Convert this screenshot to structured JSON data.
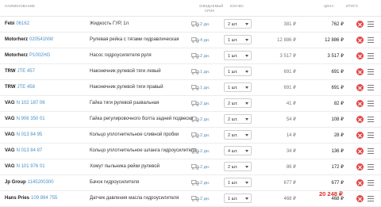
{
  "header": {
    "name": "НАИМЕНОВАНИЕ",
    "term_line1": "ОЖИДАЕМЫЙ",
    "term_line2": "СРОК",
    "qty": "КОЛ-ВО",
    "price": "ЦЕНА",
    "total": "ИТОГО"
  },
  "rows": [
    {
      "brand": "Febi",
      "article": "06162",
      "title": "Жидкость ГУР, 1л",
      "term": "2 дн.",
      "qty": "2 шт.",
      "price": "381 ₽",
      "total": "762 ₽"
    },
    {
      "brand": "Motorherz",
      "article": "020541NW",
      "title": "Рулевая рейка с тягами гидравлическая",
      "term": "4 дн.",
      "qty": "1 шт.",
      "price": "12 886 ₽",
      "total": "12 886 ₽"
    },
    {
      "brand": "Motorherz",
      "article": "P1002HG",
      "title": "Насос гидроусилителя руля",
      "term": "2 дн.",
      "qty": "1 шт.",
      "price": "3 517 ₽",
      "total": "3 517 ₽"
    },
    {
      "brand": "TRW",
      "article": "JTE 457",
      "title": "Наконечник рулевой тяги левый",
      "term": "1 дн.",
      "qty": "1 шт.",
      "price": "691 ₽",
      "total": "691 ₽"
    },
    {
      "brand": "TRW",
      "article": "JTE 458",
      "title": "Наконечник рулевой тяги правый",
      "term": "1 дн.",
      "qty": "1 шт.",
      "price": "691 ₽",
      "total": "691 ₽"
    },
    {
      "brand": "VAG",
      "article": "N 102 187 06",
      "title": "Гайка тяги рулевой развальная",
      "term": "2 дн.",
      "qty": "2 шт.",
      "price": "41 ₽",
      "total": "82 ₽"
    },
    {
      "brand": "VAG",
      "article": "N 906 350 01",
      "title": "Гайка регулировочного болта задней подвески",
      "term": "2 дн.",
      "qty": "2 шт.",
      "price": "54 ₽",
      "total": "108 ₽"
    },
    {
      "brand": "VAG",
      "article": "N 013 84 95",
      "title": "Кольцо уплотнительное сливной пробки",
      "term": "2 дн.",
      "qty": "2 шт.",
      "price": "14 ₽",
      "total": "28 ₽"
    },
    {
      "brand": "VAG",
      "article": "N 013 84 87",
      "title": "Кольцо уплотнительное шланга гидроусилителя",
      "term": "2 дн.",
      "qty": "4 шт.",
      "price": "34 ₽",
      "total": "136 ₽"
    },
    {
      "brand": "VAG",
      "article": "N 101 976 01",
      "title": "Хомут пыльника рейки рулевой",
      "term": "2 дн.",
      "qty": "2 шт.",
      "price": "86 ₽",
      "total": "172 ₽"
    },
    {
      "brand": "Jp Group",
      "article": "1145200300",
      "title": "Бачок гидроусилителя",
      "term": "2 дн.",
      "qty": "1 шт.",
      "price": "677 ₽",
      "total": "677 ₽"
    },
    {
      "brand": "Hans Pries",
      "article": "109 894 755",
      "title": "Датчик давления масла гидроусилителя",
      "term": "2 дн.",
      "qty": "1 шт.",
      "price": "468 ₽",
      "total": "468 ₽"
    }
  ],
  "summary": {
    "total": "20 248 ₽"
  },
  "icons": {
    "delivery": "truck-icon",
    "remove": "remove-icon",
    "menu": "menu-icon"
  },
  "colors": {
    "accent": "#4a90c8",
    "danger": "#e04a4a",
    "total": "#d6332a"
  }
}
